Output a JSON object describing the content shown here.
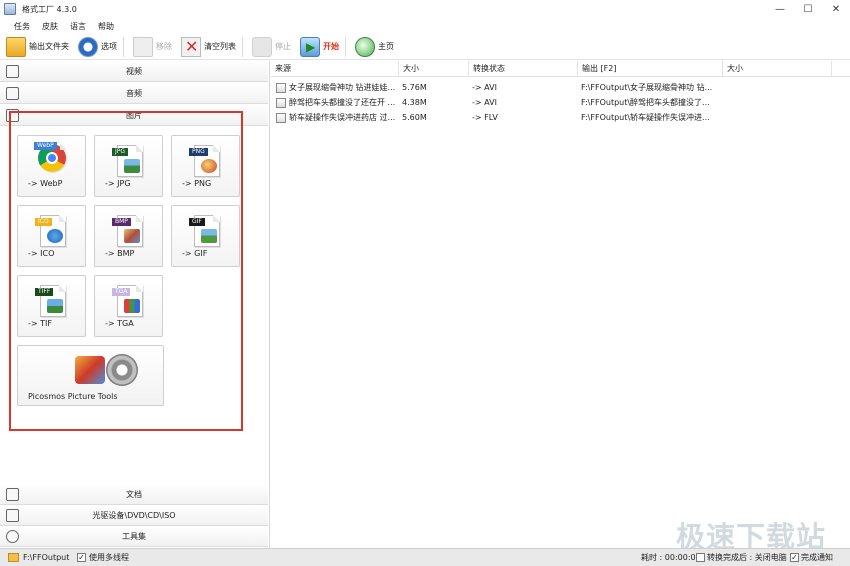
{
  "window": {
    "title": "格式工厂 4.3.0",
    "controls": {
      "minimize": "—",
      "maximize": "☐",
      "close": "✕"
    }
  },
  "menu": [
    "任务",
    "皮肤",
    "语言",
    "帮助"
  ],
  "toolbar": {
    "output_folder": "输出文件夹",
    "options": "选项",
    "remove": "移除",
    "clear_list": "清空列表",
    "stop": "停止",
    "start": "开始",
    "home": "主页"
  },
  "sidebar": {
    "video": "视频",
    "audio": "音频",
    "picture": "图片",
    "document": "文档",
    "disc": "光驱设备\\DVD\\CD\\ISO",
    "tools": "工具集"
  },
  "picture_tiles": [
    {
      "label": "-> WebP",
      "badge": "WebP",
      "icon": "chrome-icon",
      "accent": "#3b7fd6"
    },
    {
      "label": "-> JPG",
      "badge": "JPG",
      "icon": "jpg-file-icon",
      "accent": "#1d5a2a"
    },
    {
      "label": "-> PNG",
      "badge": "PNG",
      "icon": "png-file-icon",
      "accent": "#1e3c6e"
    },
    {
      "label": "-> ICO",
      "badge": "ICO",
      "icon": "ico-file-icon",
      "accent": "#f2b21c"
    },
    {
      "label": "-> BMP",
      "badge": "BMP",
      "icon": "bmp-file-icon",
      "accent": "#5b2a6e"
    },
    {
      "label": "-> GIF",
      "badge": "GIF",
      "icon": "gif-file-icon",
      "accent": "#1a1a1a"
    },
    {
      "label": "-> TIF",
      "badge": "TIFF",
      "icon": "tif-file-icon",
      "accent": "#1a4a1a"
    },
    {
      "label": "-> TGA",
      "badge": "TGA",
      "icon": "tga-file-icon",
      "accent": "#c7b6e0"
    }
  ],
  "picosmos": {
    "label": "Picosmos Picture Tools"
  },
  "list": {
    "columns": [
      "来源",
      "大小",
      "转换状态",
      "输出 [F2]",
      "大小"
    ],
    "rows": [
      {
        "source": "女子展现缩骨神功 钻进娃娃...",
        "size": "5.76M",
        "status": "-> AVI",
        "output": "F:\\FFOutput\\女子展现缩骨神功 钻...",
        "out_size": ""
      },
      {
        "source": "醉驾把车头都撞没了还在开 ...",
        "size": "4.38M",
        "status": "-> AVI",
        "output": "F:\\FFOutput\\醉驾把车头都撞没了...",
        "out_size": ""
      },
      {
        "source": "轿车疑操作失误冲进药店 过...",
        "size": "5.60M",
        "status": "-> FLV",
        "output": "F:\\FFOutput\\轿车疑操作失误冲进...",
        "out_size": ""
      }
    ]
  },
  "status": {
    "output_path": "F:\\FFOutput",
    "multithread": "使用多线程",
    "elapsed": "耗时 : 00:00:00",
    "after_done": "转换完成后 : 关闭电脑",
    "notify": "完成通知"
  },
  "watermark": "极速下载站"
}
